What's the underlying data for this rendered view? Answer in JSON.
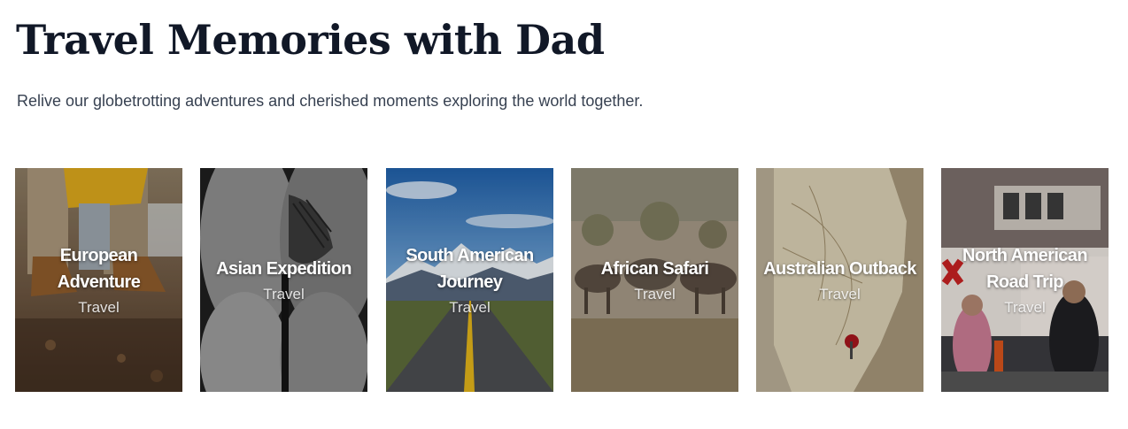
{
  "header": {
    "title": "Travel Memories with Dad",
    "subtitle": "Relive our globetrotting adventures and cherished moments exploring the world together."
  },
  "cards": [
    {
      "title": "European Adventure",
      "category": "Travel",
      "image": "boots-on-ground-photo"
    },
    {
      "title": "Asian Expedition",
      "category": "Travel",
      "image": "tattooed-legs-bw-photo"
    },
    {
      "title": "South American Journey",
      "category": "Travel",
      "image": "mountain-road-photo"
    },
    {
      "title": "African Safari",
      "category": "Travel",
      "image": "wildebeest-savanna-photo"
    },
    {
      "title": "Australian Outback",
      "category": "Travel",
      "image": "australia-map-pin-photo"
    },
    {
      "title": "North American Road Trip",
      "category": "Travel",
      "image": "city-street-people-photo"
    }
  ]
}
